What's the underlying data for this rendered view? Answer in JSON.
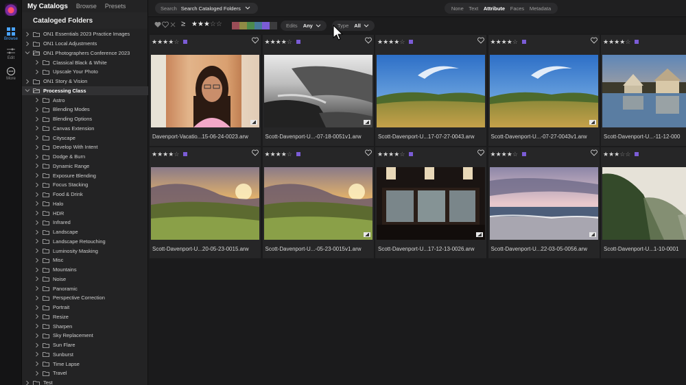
{
  "rail": {
    "items": [
      {
        "label": "Browse",
        "icon": "grid-icon",
        "active": true
      },
      {
        "label": "Edit",
        "icon": "sliders-icon",
        "active": false
      },
      {
        "label": "More",
        "icon": "more-icon",
        "active": false
      }
    ]
  },
  "sidebar": {
    "tabs": [
      "My Catalogs",
      "Browse",
      "Presets"
    ],
    "section_title": "Cataloged Folders",
    "tree": [
      {
        "label": "ON1 Essentials 2023 Practice Images",
        "level": 0,
        "expanded": false
      },
      {
        "label": "ON1 Local Adjustments",
        "level": 0,
        "expanded": false
      },
      {
        "label": "ON1 Photographers Conference 2023",
        "level": 0,
        "expanded": true
      },
      {
        "label": "Classical Black & White",
        "level": 1,
        "expanded": false
      },
      {
        "label": "Upscale Your Photo",
        "level": 1,
        "expanded": false
      },
      {
        "label": "ON1 Story & Vision",
        "level": 0,
        "expanded": false
      },
      {
        "label": "Processing Class",
        "level": 0,
        "expanded": true,
        "selected": true
      },
      {
        "label": "Astro",
        "level": 1,
        "expanded": false
      },
      {
        "label": "Blending Modes",
        "level": 1,
        "expanded": false
      },
      {
        "label": "Blending Options",
        "level": 1,
        "expanded": false
      },
      {
        "label": "Canvas Extension",
        "level": 1,
        "expanded": false
      },
      {
        "label": "Cityscape",
        "level": 1,
        "expanded": false
      },
      {
        "label": "Develop With Intent",
        "level": 1,
        "expanded": false
      },
      {
        "label": "Dodge & Burn",
        "level": 1,
        "expanded": false
      },
      {
        "label": "Dynamic Range",
        "level": 1,
        "expanded": false
      },
      {
        "label": "Exposure Blending",
        "level": 1,
        "expanded": false
      },
      {
        "label": "Focus Stacking",
        "level": 1,
        "expanded": false
      },
      {
        "label": "Food & Drink",
        "level": 1,
        "expanded": false
      },
      {
        "label": "Halo",
        "level": 1,
        "expanded": false
      },
      {
        "label": "HDR",
        "level": 1,
        "expanded": false
      },
      {
        "label": "Infrared",
        "level": 1,
        "expanded": false
      },
      {
        "label": "Landscape",
        "level": 1,
        "expanded": false
      },
      {
        "label": "Landscape Retouching",
        "level": 1,
        "expanded": false
      },
      {
        "label": "Luminosity Masking",
        "level": 1,
        "expanded": false
      },
      {
        "label": "Misc",
        "level": 1,
        "expanded": false
      },
      {
        "label": "Mountains",
        "level": 1,
        "expanded": false
      },
      {
        "label": "Noise",
        "level": 1,
        "expanded": false
      },
      {
        "label": "Panoramic",
        "level": 1,
        "expanded": false
      },
      {
        "label": "Perspective Correction",
        "level": 1,
        "expanded": false
      },
      {
        "label": "Portrait",
        "level": 1,
        "expanded": false
      },
      {
        "label": "Resize",
        "level": 1,
        "expanded": false
      },
      {
        "label": "Sharpen",
        "level": 1,
        "expanded": false
      },
      {
        "label": "Sky Replacement",
        "level": 1,
        "expanded": false
      },
      {
        "label": "Sun Flare",
        "level": 1,
        "expanded": false
      },
      {
        "label": "Sunburst",
        "level": 1,
        "expanded": false
      },
      {
        "label": "Time Lapse",
        "level": 1,
        "expanded": false
      },
      {
        "label": "Travel",
        "level": 1,
        "expanded": false
      },
      {
        "label": "Test",
        "level": 0,
        "expanded": false
      }
    ]
  },
  "topbar": {
    "search_label": "Search",
    "search_value": "Search Cataloged Folders",
    "modes": [
      "None",
      "Text",
      "Attribute",
      "Faces",
      "Metadata"
    ],
    "active_mode": "Attribute"
  },
  "filters": {
    "gte_symbol": "≥",
    "star_filter": 3,
    "color_swatches": [
      "#9a4d57",
      "#8f8a45",
      "#4c8a4c",
      "#477a99",
      "#7b5cd6",
      "#3b3b3d"
    ],
    "edits_label": "Edits",
    "edits_value": "Any",
    "type_label": "Type",
    "type_value": "All"
  },
  "photos": [
    {
      "filename": "Davenport-Vacatio...15-06-24-0023.arw",
      "rating": 4,
      "scene": "portrait",
      "badge": true
    },
    {
      "filename": "Scott-Davenport-U...-07-18-0051v1.arw",
      "rating": 4,
      "scene": "bwcoast",
      "badge": true
    },
    {
      "filename": "Scott-Davenport-U...17-07-27-0043.arw",
      "rating": 4,
      "scene": "meadow",
      "badge": false
    },
    {
      "filename": "Scott-Davenport-U...-07-27-0043v1.arw",
      "rating": 4,
      "scene": "meadow",
      "badge": true
    },
    {
      "filename": "Scott-Davenport-U...-11-12-000",
      "rating": 4,
      "scene": "lakehouse",
      "badge": false
    },
    {
      "filename": "Scott-Davenport-U...20-05-23-0015.arw",
      "rating": 4,
      "scene": "sunset",
      "badge": false
    },
    {
      "filename": "Scott-Davenport-U...-05-23-0015v1.arw",
      "rating": 4,
      "scene": "sunset",
      "badge": true
    },
    {
      "filename": "Scott-Davenport-U...17-12-13-0026.arw",
      "rating": 4,
      "scene": "bar",
      "badge": true
    },
    {
      "filename": "Scott-Davenport-U...22-03-05-0056.arw",
      "rating": 4,
      "scene": "beach",
      "badge": true
    },
    {
      "filename": "Scott-Davenport-U...1-10-0001",
      "rating": 3,
      "scene": "fogcoast",
      "badge": false
    }
  ]
}
